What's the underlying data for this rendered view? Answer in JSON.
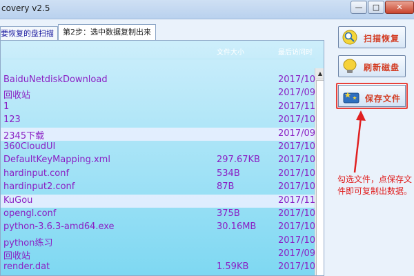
{
  "window": {
    "title": "covery v2.5",
    "min_glyph": "—",
    "max_glyph": "□",
    "close_glyph": "✕"
  },
  "tabs": [
    {
      "label": "要恢复的盘扫描"
    },
    {
      "label": "第2步：选中数据复制出来"
    }
  ],
  "columns": {
    "size": "文件大小",
    "date": "最后访问时"
  },
  "rows": [
    {
      "name": "BaiduNetdiskDownload",
      "size": "",
      "date": "2017/10"
    },
    {
      "name": "回收站",
      "size": "",
      "date": "2017/09"
    },
    {
      "name": "1",
      "size": "",
      "date": "2017/11"
    },
    {
      "name": "123",
      "size": "",
      "date": "2017/10"
    },
    {
      "name": "2345下载",
      "size": "",
      "date": "2017/09",
      "selected": true
    },
    {
      "name": "360CloudUI",
      "size": "",
      "date": "2017/10"
    },
    {
      "name": "DefaultKeyMapping.xml",
      "size": "297.67KB",
      "date": "2017/10"
    },
    {
      "name": "hardinput.conf",
      "size": "534B",
      "date": "2017/10"
    },
    {
      "name": "hardinput2.conf",
      "size": "87B",
      "date": "2017/10"
    },
    {
      "name": "KuGou",
      "size": "",
      "date": "2017/11",
      "selected": true
    },
    {
      "name": "opengl.conf",
      "size": "375B",
      "date": "2017/10"
    },
    {
      "name": "python-3.6.3-amd64.exe",
      "size": "30.16MB",
      "date": "2017/10"
    },
    {
      "name": "python练习",
      "size": "",
      "date": "2017/10"
    },
    {
      "name": "回收站",
      "size": "",
      "date": "2017/09"
    },
    {
      "name": "render.dat",
      "size": "1.59KB",
      "date": "2017/10"
    }
  ],
  "sidebar": {
    "scan_label": "扫描恢复",
    "refresh_label": "刷新磁盘",
    "save_label": "保存文件"
  },
  "annotation": {
    "text": "勾选文件，点保存文件即可复制出数据。"
  },
  "colors": {
    "row_text": "#8a1fc4",
    "panel_top": "#cdeefb",
    "panel_bottom": "#7ed8f2",
    "annotation": "#e02020"
  }
}
